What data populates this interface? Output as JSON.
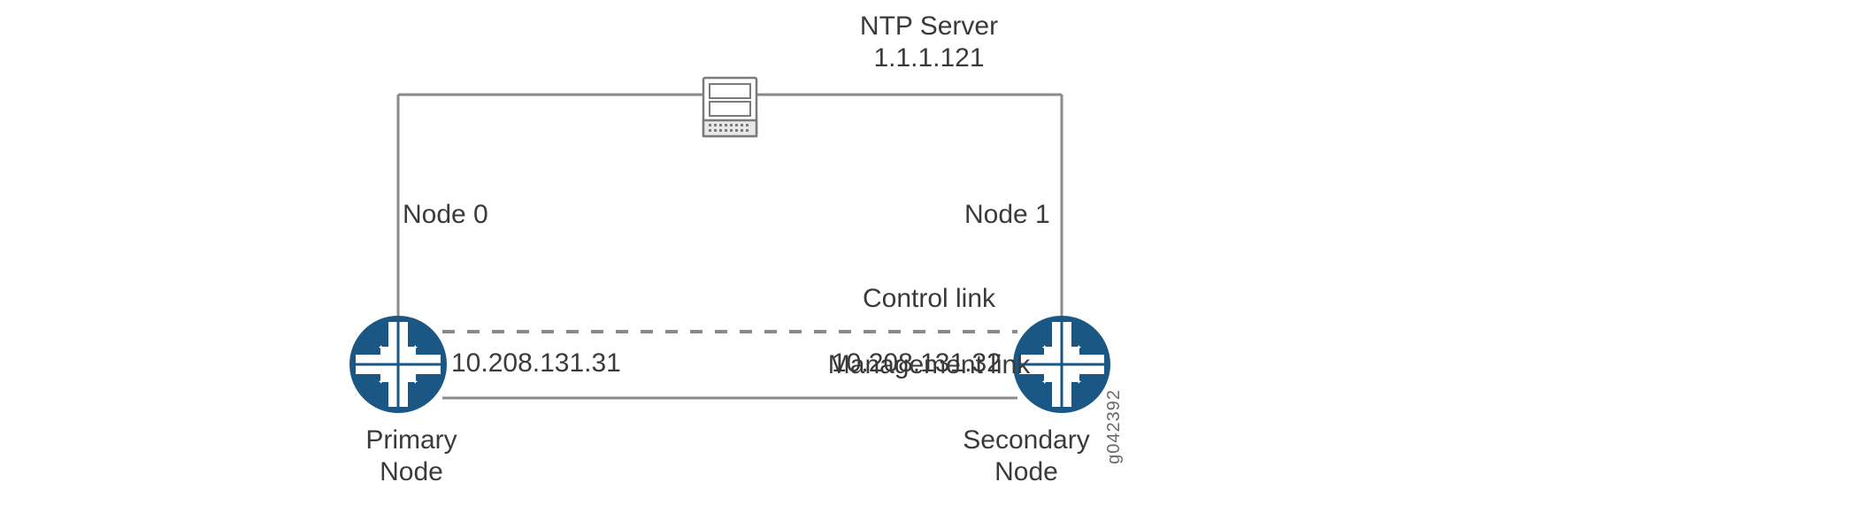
{
  "ntp": {
    "title": "NTP Server",
    "ip": "1.1.1.121"
  },
  "node0": {
    "label": "Node 0",
    "role1": "Primary",
    "role2": "Node",
    "mgmt_ip": "10.208.131.31"
  },
  "node1": {
    "label": "Node 1",
    "role1": "Secondary",
    "role2": "Node",
    "mgmt_ip": "10.208.131.32"
  },
  "links": {
    "control": "Control link",
    "management": "Management link"
  },
  "figure_id": "g042392",
  "colors": {
    "router_fill": "#1a5785",
    "line": "#8a8a8a"
  }
}
